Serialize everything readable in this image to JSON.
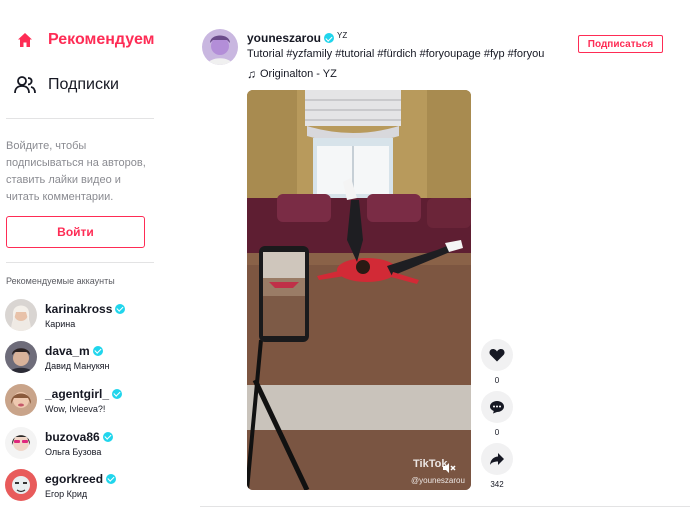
{
  "sidebar": {
    "nav": [
      {
        "label": "Рекомендуем",
        "icon": "home-icon",
        "active": true
      },
      {
        "label": "Подписки",
        "icon": "users-icon",
        "active": false
      }
    ],
    "login_prompt": "Войдите, чтобы подписываться на авторов, ставить лайки видео и читать комментарии.",
    "login_button": "Войти",
    "recommended_title": "Рекомендуемые аккаунты",
    "accounts": [
      {
        "username": "karinakross",
        "name": "Карина"
      },
      {
        "username": "dava_m",
        "name": "Давид Манукян"
      },
      {
        "username": "_agentgirl_",
        "name": "Wow, Ivleeva?!"
      },
      {
        "username": "buzova86",
        "name": "Ольга Бузова"
      },
      {
        "username": "egorkreed",
        "name": "Егор Крид"
      }
    ]
  },
  "post": {
    "username": "youneszarou",
    "nickname": "YZ",
    "description": "Tutorial #yzfamily #tutorial #fürdich #foryoupage #fyp #foryou",
    "music": "Originalton - YZ",
    "follow_button": "Подписаться",
    "watermark": "TikTok",
    "watermark_user": "@youneszarou",
    "actions": [
      {
        "icon": "heart-icon",
        "count": "0"
      },
      {
        "icon": "comment-icon",
        "count": "0"
      },
      {
        "icon": "share-icon",
        "count": "342"
      }
    ]
  },
  "colors": {
    "accent": "#fe2c55",
    "verified": "#20d5ec",
    "muted_text": "#8a8b91"
  }
}
